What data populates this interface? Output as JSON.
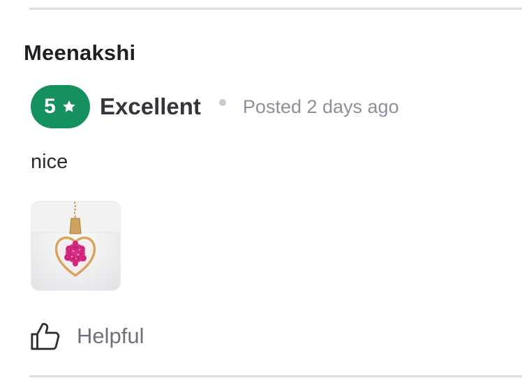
{
  "review": {
    "reviewer": "Meenakshi",
    "rating": "5",
    "rating_label": "Excellent",
    "posted": "Posted 2 days ago",
    "body": "nice",
    "helpful_label": "Helpful"
  },
  "colors": {
    "badge": "#15915f",
    "divider": "#dcdde2",
    "muted_text": "#8d8f9c"
  },
  "icons": {
    "star": "star-icon",
    "helpful": "thumbs-up-icon"
  }
}
